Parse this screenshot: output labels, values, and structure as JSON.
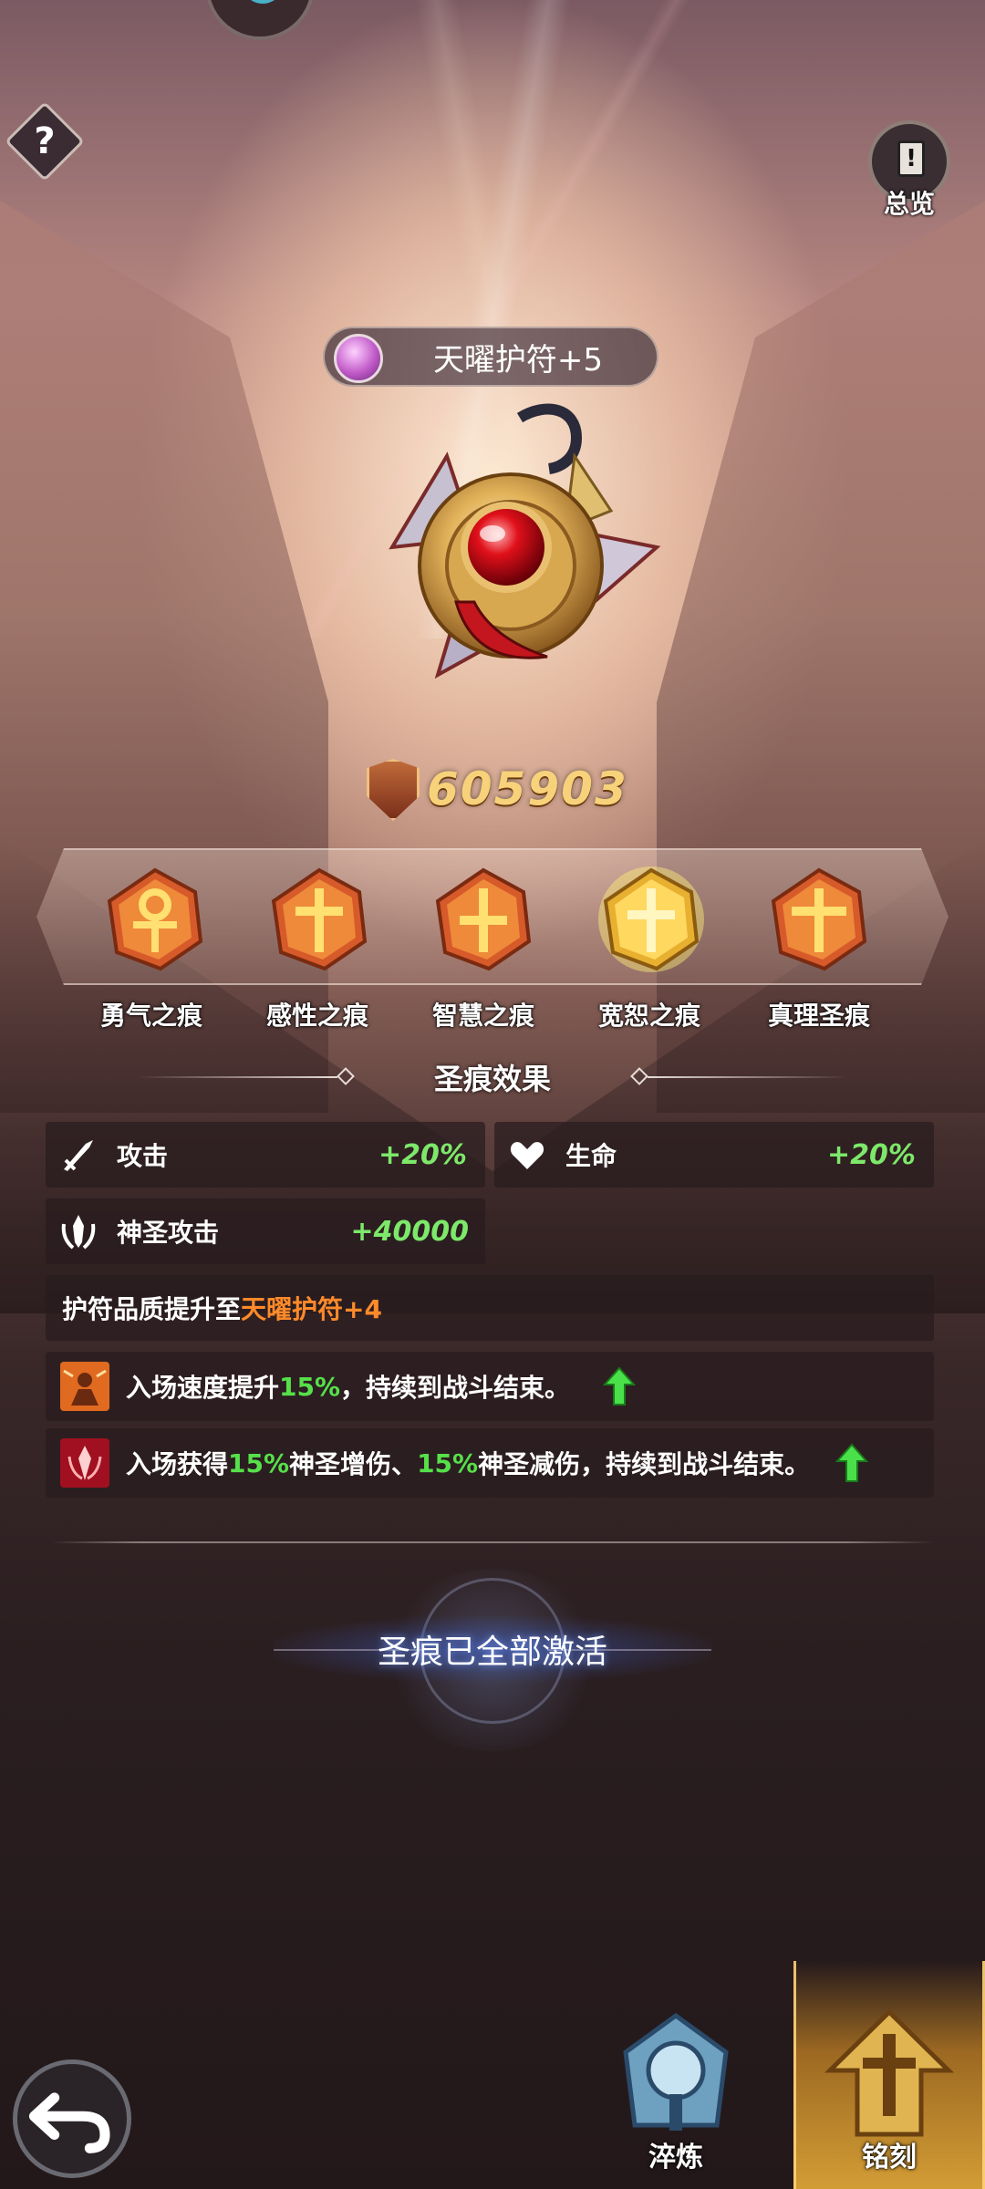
{
  "header": {
    "help_label": "?",
    "overview_label": "总览",
    "overview_icon_glyph": "!"
  },
  "amulet": {
    "name": "天曜护符+5",
    "power": "605903"
  },
  "stigmas": [
    {
      "label": "勇气之痕",
      "icon": "ankh-icon",
      "highlighted": false
    },
    {
      "label": "感性之痕",
      "icon": "cross-icon",
      "highlighted": false
    },
    {
      "label": "智慧之痕",
      "icon": "cross-icon",
      "highlighted": false
    },
    {
      "label": "宽恕之痕",
      "icon": "cross-icon",
      "highlighted": true
    },
    {
      "label": "真理圣痕",
      "icon": "cross-icon",
      "highlighted": false
    }
  ],
  "effects": {
    "title": "圣痕效果",
    "stats": [
      {
        "label": "攻击",
        "value": "+20%",
        "icon": "sword-icon"
      },
      {
        "label": "生命",
        "value": "+20%",
        "icon": "heart-icon"
      },
      {
        "label": "神圣攻击",
        "value": "+40000",
        "icon": "holy-attack-icon"
      }
    ],
    "quality": {
      "prefix": "护符品质提升至",
      "highlight": "天曜护符+4"
    },
    "skills": [
      {
        "parts": [
          "入场速度提升",
          "15%",
          "，持续到战斗结束。"
        ]
      },
      {
        "parts": [
          "入场获得",
          "15%",
          "神圣增伤、",
          "15%",
          "神圣减伤，持续到战斗结束。"
        ]
      }
    ]
  },
  "status": {
    "activated": "圣痕已全部激活"
  },
  "nav": {
    "back_icon": "back-arrow-icon",
    "items": [
      {
        "label": "淬炼",
        "active": false
      },
      {
        "label": "铭刻",
        "active": true
      }
    ]
  },
  "colors": {
    "value_green": "#7de86a",
    "highlight_orange": "#ff8a2a",
    "power_gold": "#f7d27a",
    "nav_active": "#ffb43c"
  }
}
